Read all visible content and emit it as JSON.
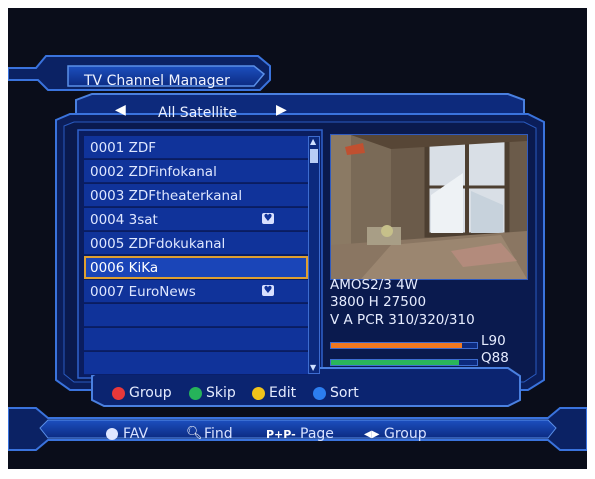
{
  "header": {
    "title": "TV Channel Manager"
  },
  "satellite_selector": {
    "left_arrow": "◀",
    "name": "All Satellite",
    "right_arrow": "▶"
  },
  "channels": [
    {
      "label": "0001 ZDF",
      "fav": false
    },
    {
      "label": "0002 ZDFinfokanal",
      "fav": false
    },
    {
      "label": "0003 ZDFtheaterkanal",
      "fav": false
    },
    {
      "label": "0004 3sat",
      "fav": true
    },
    {
      "label": "0005 ZDFdokukanal",
      "fav": false
    },
    {
      "label": "0006 KiKa",
      "fav": false,
      "selected": true
    },
    {
      "label": "0007 EuroNews",
      "fav": true
    },
    {
      "label": "",
      "fav": false
    },
    {
      "label": "",
      "fav": false
    },
    {
      "label": "",
      "fav": false
    }
  ],
  "info": {
    "satellite": "AMOS2/3 4W",
    "transponder": "3800 H 27500",
    "pids": "V A PCR 310/320/310",
    "level_label": "L90",
    "quality_label": "Q88",
    "level": 0.9,
    "quality": 0.88
  },
  "legend": {
    "group": "Group",
    "skip": "Skip",
    "edit": "Edit",
    "sort": "Sort"
  },
  "help": {
    "fav": "FAV",
    "find": "Find",
    "page_key": "P+P-",
    "page": "Page",
    "group_key": "◀▶",
    "group": "Group"
  },
  "colors": {
    "red": "#e8383a",
    "green": "#26b35a",
    "yellow": "#f0c21a",
    "blue": "#2c7ef0",
    "frame": "#2e62cc",
    "row": "#10339a",
    "selected_border": "#e0a030"
  }
}
